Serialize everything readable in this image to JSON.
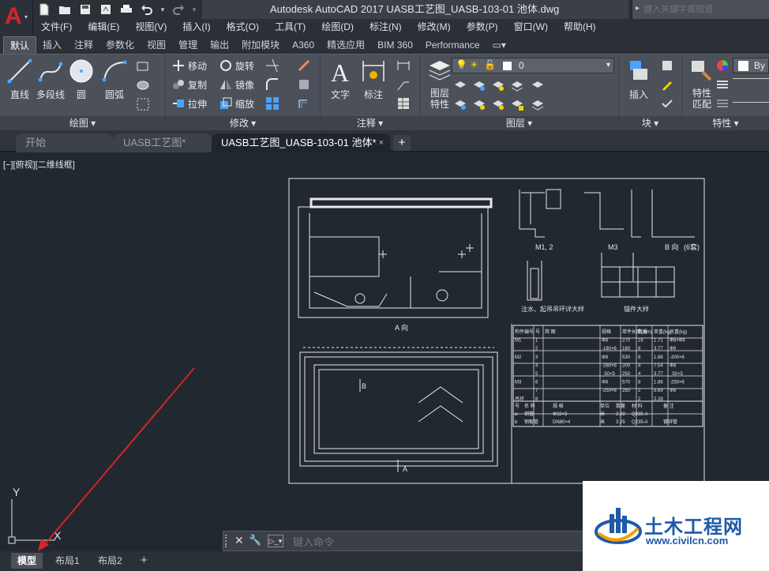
{
  "app": {
    "title": "Autodesk AutoCAD 2017    UASB工艺图_UASB-103-01 池体.dwg",
    "search_placeholder": "键入关键字或短语",
    "logo_letter": "A"
  },
  "menubar": [
    "文件(F)",
    "编辑(E)",
    "视图(V)",
    "插入(I)",
    "格式(O)",
    "工具(T)",
    "绘图(D)",
    "标注(N)",
    "修改(M)",
    "参数(P)",
    "窗口(W)",
    "帮助(H)"
  ],
  "ribbon_tabs": [
    "默认",
    "插入",
    "注释",
    "参数化",
    "视图",
    "管理",
    "输出",
    "附加模块",
    "A360",
    "精选应用",
    "BIM 360",
    "Performance",
    "▭▾"
  ],
  "ribbon": {
    "draw": {
      "title": "绘图 ▾",
      "line": "直线",
      "polyline": "多段线",
      "circle": "圆",
      "arc": "圆弧"
    },
    "modify": {
      "title": "修改 ▾",
      "move": "移动",
      "rotate": "旋转",
      "copy": "复制",
      "mirror": "镜像",
      "stretch": "拉伸",
      "scale": "缩放"
    },
    "annotation": {
      "title": "注释 ▾",
      "text": "文字",
      "dimension": "标注"
    },
    "layers": {
      "title": "图层 ▾",
      "layer_props": "图层\n特性",
      "layer_props_1": "图层",
      "layer_props_2": "特性",
      "current_layer": "0"
    },
    "block": {
      "title": "块 ▾",
      "insert": "插入"
    },
    "properties": {
      "title": "特性 ▾",
      "match_1": "特性",
      "match_2": "匹配",
      "by": "By"
    }
  },
  "doc_tabs": [
    {
      "label": "开始",
      "active": false
    },
    {
      "label": "UASB工艺图*",
      "active": false
    },
    {
      "label": "UASB工艺图_UASB-103-01 池体*",
      "active": true,
      "close": "×"
    }
  ],
  "new_tab": "+",
  "viewport_label": "[−][俯视][二维线框]",
  "ucs": {
    "y": "Y",
    "x": "X"
  },
  "command_line": {
    "placeholder": "键入命令",
    "close": "✕",
    "settings": "🔧",
    "prompt": "▷_▾"
  },
  "layout_tabs": [
    "模型",
    "布局1",
    "布局2",
    "+"
  ],
  "drawing": {
    "labels": {
      "view_a": "A 向",
      "view_b": "B 向",
      "section_a": "A",
      "section_b": "B",
      "m1m2": "M1, 2",
      "m3": "M3",
      "b_view": "B 向",
      "b_count": "(6套)",
      "note1": "注水、起吊吊环详大样",
      "note2": "锚件大样"
    },
    "table_header": [
      "构件编号",
      "号",
      "简   图",
      "规格",
      "单件长度(mm)",
      "数量",
      "单重(kg)",
      "总重(kg)"
    ],
    "table_rows": [
      [
        "M1",
        "1",
        "",
        "Φ8",
        "270",
        "16",
        "1.71",
        "Φ8×Φ6"
      ],
      [
        "",
        "2",
        "",
        "-180×6",
        "180",
        "8",
        "3.77",
        "Φ8"
      ],
      [
        "M2",
        "3",
        "",
        "Φ8",
        "530",
        "8",
        "1.68",
        "-200×6"
      ],
      [
        "",
        "4",
        "",
        "-280×6",
        "200",
        "4",
        "7.54",
        "Φ8"
      ],
      [
        "",
        "5",
        "",
        "_50×5",
        "250",
        "4",
        "3.77",
        "_50×5"
      ],
      [
        "M3",
        "6",
        "",
        "Φ8",
        "570",
        "8",
        "1.86",
        "-250×6"
      ],
      [
        "",
        "7",
        "",
        "-250×6",
        "250",
        "2",
        "5.69",
        "Φ8"
      ],
      [
        "吊环",
        "8",
        "",
        "",
        "",
        "2",
        "2.28",
        ""
      ]
    ],
    "table_footer": [
      [
        "号",
        "名 称",
        "规 格",
        "单位",
        "数量",
        "材 料",
        "备 注"
      ],
      [
        "a",
        "钢管",
        "Φ32×3",
        "米",
        "2.28",
        "Q235-A",
        ""
      ],
      [
        "b",
        "钢板管",
        "DN80×4",
        "米",
        "3.25",
        "Q235-A",
        "镀锌管"
      ]
    ]
  },
  "watermark": {
    "brand": "土木工程网",
    "url": "www.civilcn.com"
  },
  "colors": {
    "accent_red": "#d6242b",
    "canvas_bg": "#212830",
    "ribbon_bg": "#4b5059",
    "brand_blue": "#1e5aa8"
  }
}
